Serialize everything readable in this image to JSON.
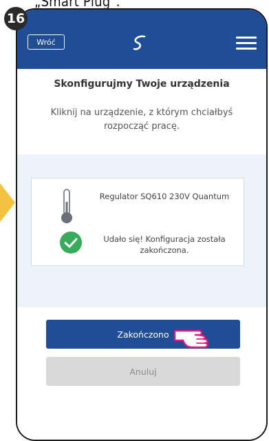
{
  "caption": "„Smart Plug\".",
  "step_number": "16",
  "header": {
    "back_label": "Wróć"
  },
  "main": {
    "title": "Skonfigurujmy Twoje urządzenia",
    "subtitle": "Kliknij na urządzenie, z którym chciałbyś rozpocząć pracę."
  },
  "device": {
    "name": "Regulator SQ610 230V Quantum",
    "status": "Udało się! Konfiguracja została zakończona."
  },
  "actions": {
    "finish_label": "Zakończono",
    "cancel_label": "Anuluj"
  },
  "colors": {
    "brand": "#1f4d96",
    "success": "#3aaa5b",
    "highlight": "#f3c23f",
    "pointer": "#e0197a"
  },
  "icons": [
    "logo-icon",
    "menu-icon",
    "thermometer-icon",
    "check-icon",
    "hand-pointer-icon"
  ]
}
